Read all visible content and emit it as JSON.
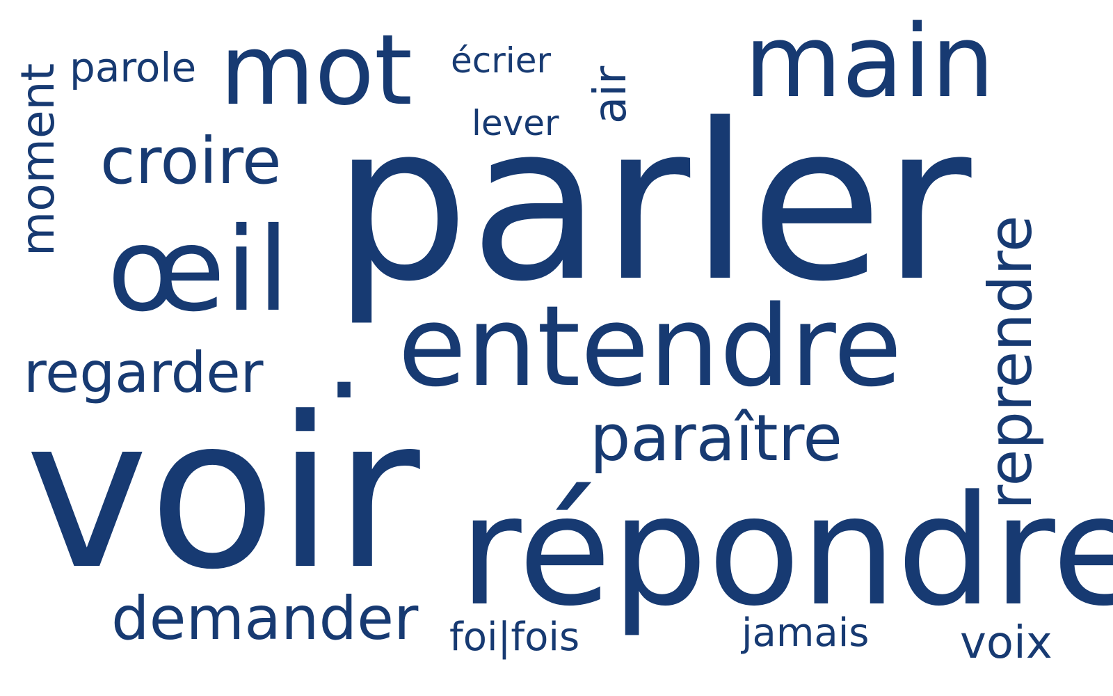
{
  "colors": {
    "word": "#173a72",
    "background": "#ffffff"
  },
  "words": {
    "moment": "moment",
    "parole": "parole",
    "mot": "mot",
    "ecrier": "écrier",
    "air": "air",
    "main": "main",
    "lever": "lever",
    "croire": "croire",
    "parler": "parler",
    "reprendre": "reprendre",
    "oeil": "œil",
    "regarder": "regarder",
    "entendre": "entendre",
    "dot": ".",
    "paraitre": "paraître",
    "voir": "voir",
    "repondre": "répondre",
    "demander": "demander",
    "foi_fois": "foi|fois",
    "jamais": "jamais",
    "voix": "voix"
  }
}
